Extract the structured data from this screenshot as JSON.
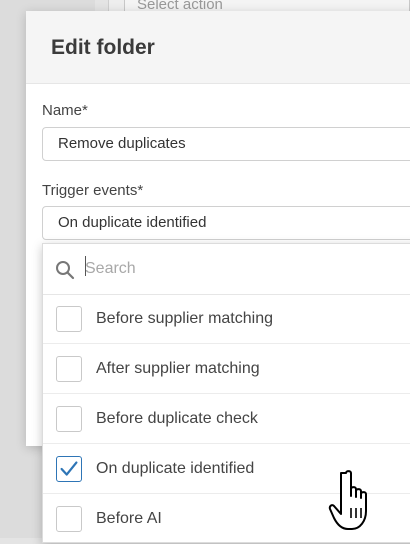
{
  "background": {
    "select_action_placeholder": "Select action"
  },
  "modal": {
    "title": "Edit folder",
    "name_label": "Name*",
    "name_value": "Remove duplicates",
    "trigger_label": "Trigger events*",
    "trigger_value": "On duplicate identified"
  },
  "dropdown": {
    "search_placeholder": "Search",
    "options": [
      {
        "label": "Before supplier matching",
        "checked": false
      },
      {
        "label": "After supplier matching",
        "checked": false
      },
      {
        "label": "Before duplicate check",
        "checked": false
      },
      {
        "label": "On duplicate identified",
        "checked": true
      },
      {
        "label": "Before AI",
        "checked": false
      }
    ]
  },
  "colors": {
    "accent": "#2e75b6",
    "header_bg": "#f5f5f5",
    "text": "#444444"
  },
  "icons": {
    "search": "search-icon",
    "check": "checkmark-icon",
    "pointer": "hand-pointer-icon"
  }
}
